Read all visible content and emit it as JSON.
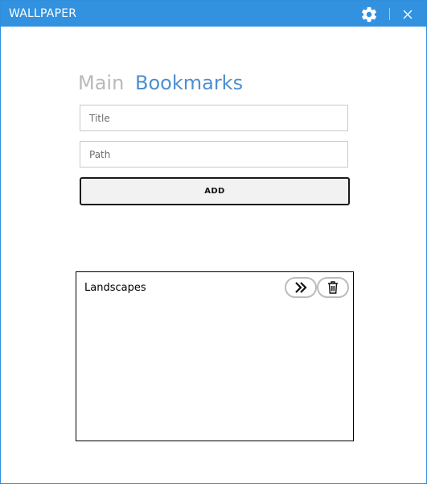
{
  "window": {
    "title": "WALLPAPER",
    "settings_icon": "gear-icon",
    "close_icon": "close-icon"
  },
  "nav": {
    "main_label": "Main",
    "bookmarks_label": "Bookmarks",
    "active": "Bookmarks"
  },
  "form": {
    "title_placeholder": "Title",
    "path_placeholder": "Path",
    "title_value": "",
    "path_value": "",
    "add_label": "ADD"
  },
  "bookmarks": [
    {
      "label": "Landscapes",
      "open_icon": "double-chevron-right-icon",
      "delete_icon": "trash-icon"
    }
  ],
  "colors": {
    "titlebar": "#3292e0",
    "nav_active": "#4c8fd0",
    "nav_inactive": "#b9b9b9"
  }
}
